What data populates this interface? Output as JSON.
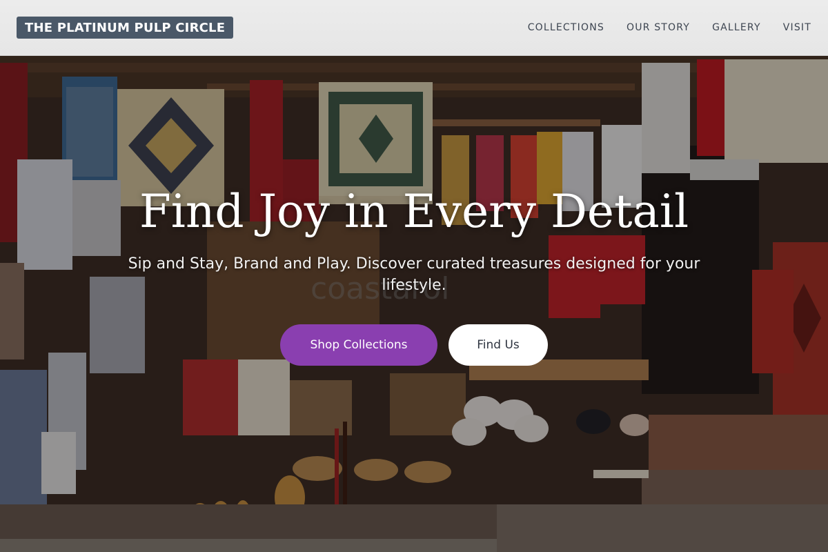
{
  "header": {
    "brand": "THE PLATINUM PULP CIRCLE",
    "nav": [
      {
        "label": "COLLECTIONS"
      },
      {
        "label": "OUR STORY"
      },
      {
        "label": "GALLERY"
      },
      {
        "label": "VISIT"
      }
    ]
  },
  "hero": {
    "headline": "Find Joy in Every Detail",
    "subheadline": "Sip and Stay, Brand and Play. Discover curated treasures designed for your lifestyle.",
    "primary_cta": "Shop Collections",
    "secondary_cta": "Find Us",
    "background_sign": "coastarol"
  },
  "colors": {
    "brand_bg": "#4a5868",
    "primary_button": "#8a3fb0",
    "secondary_button": "#ffffff"
  }
}
